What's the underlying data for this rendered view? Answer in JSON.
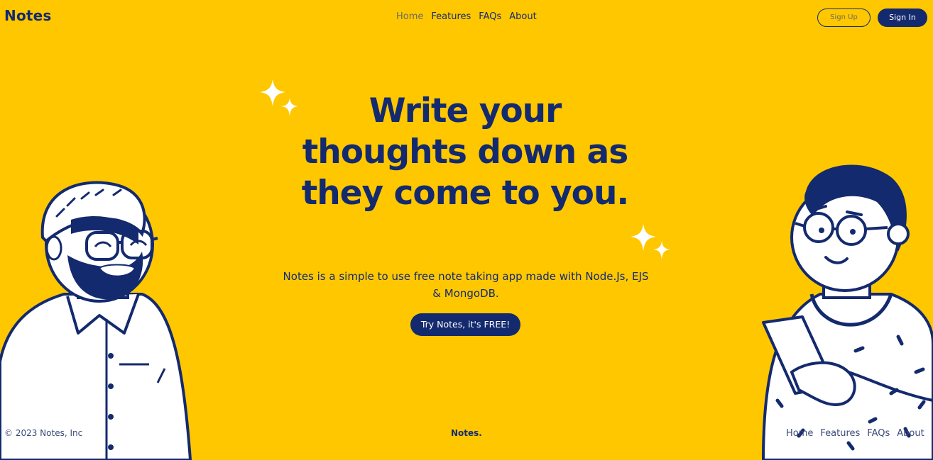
{
  "header": {
    "brand": "Notes",
    "nav": [
      {
        "label": "Home",
        "active": true
      },
      {
        "label": "Features",
        "active": false
      },
      {
        "label": "FAQs",
        "active": false
      },
      {
        "label": "About",
        "active": false
      }
    ],
    "signup_label": "Sign Up",
    "signin_label": "Sign In"
  },
  "hero": {
    "title": "Write your thoughts down as they come to you.",
    "subtitle": "Notes is a simple to use free note taking app made with Node.Js, EJS & MongoDB.",
    "cta_label": "Try Notes, it's FREE!"
  },
  "footer": {
    "copyright": "© 2023 Notes, Inc",
    "brand": "Notes.",
    "nav": [
      "Home",
      "Features",
      "FAQs",
      "About"
    ]
  },
  "colors": {
    "background": "#ffc700",
    "primary": "#142a6e",
    "white": "#ffffff"
  },
  "icons": [
    "sparkle-icon",
    "sparkle-icon"
  ]
}
